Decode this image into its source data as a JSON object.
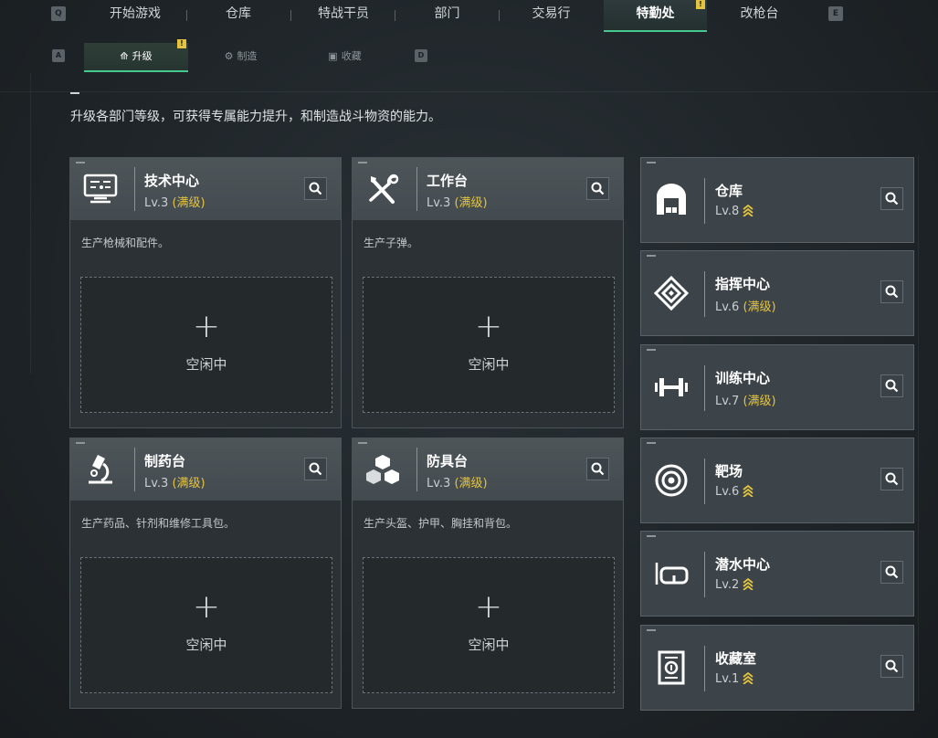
{
  "topnav": {
    "key_left": "Q",
    "key_right": "E",
    "tabs": [
      {
        "label": "开始游戏"
      },
      {
        "label": "仓库"
      },
      {
        "label": "特战干员"
      },
      {
        "label": "部门"
      },
      {
        "label": "交易行"
      },
      {
        "label": "特勤处",
        "active": true,
        "badge": "!"
      },
      {
        "label": "改枪台"
      }
    ]
  },
  "subtabs": {
    "key_left": "A",
    "key_right": "D",
    "items": [
      {
        "label": "升级",
        "icon": "upgrade-icon",
        "active": true,
        "badge": "!"
      },
      {
        "label": "制造",
        "icon": "craft-icon"
      },
      {
        "label": "收藏",
        "icon": "collection-icon"
      }
    ]
  },
  "description": "升级各部门等级，可获得专属能力提升，和制造战斗物资的能力。",
  "production_cards": [
    {
      "title": "技术中心",
      "level": "Lv.3",
      "status": "(满级)",
      "desc": "生产枪械和配件。",
      "icon": "computer-icon",
      "slot_label": "空闲中",
      "slot_plus": "+"
    },
    {
      "title": "工作台",
      "level": "Lv.3",
      "status": "(满级)",
      "desc": "生产子弹。",
      "icon": "tools-icon",
      "slot_label": "空闲中",
      "slot_plus": "+"
    },
    {
      "title": "制药台",
      "level": "Lv.3",
      "status": "(满级)",
      "desc": "生产药品、针剂和维修工具包。",
      "icon": "microscope-icon",
      "slot_label": "空闲中",
      "slot_plus": "+"
    },
    {
      "title": "防具台",
      "level": "Lv.3",
      "status": "(满级)",
      "desc": "生产头盔、护甲、胸挂和背包。",
      "icon": "cubes-icon",
      "slot_label": "空闲中",
      "slot_plus": "+"
    }
  ],
  "facilities": [
    {
      "title": "仓库",
      "level": "Lv.8",
      "status": "",
      "upgradable": true,
      "icon": "warehouse-icon"
    },
    {
      "title": "指挥中心",
      "level": "Lv.6",
      "status": "(满级)",
      "upgradable": false,
      "icon": "command-icon"
    },
    {
      "title": "训练中心",
      "level": "Lv.7",
      "status": "(满级)",
      "upgradable": false,
      "icon": "dumbbell-icon"
    },
    {
      "title": "靶场",
      "level": "Lv.6",
      "status": "",
      "upgradable": true,
      "icon": "target-icon"
    },
    {
      "title": "潜水中心",
      "level": "Lv.2",
      "status": "",
      "upgradable": true,
      "icon": "diving-mask-icon"
    },
    {
      "title": "收藏室",
      "level": "Lv.1",
      "status": "",
      "upgradable": true,
      "icon": "trophy-case-icon"
    }
  ],
  "colors": {
    "accent_green": "#46c98c",
    "gold": "#e3c441"
  }
}
